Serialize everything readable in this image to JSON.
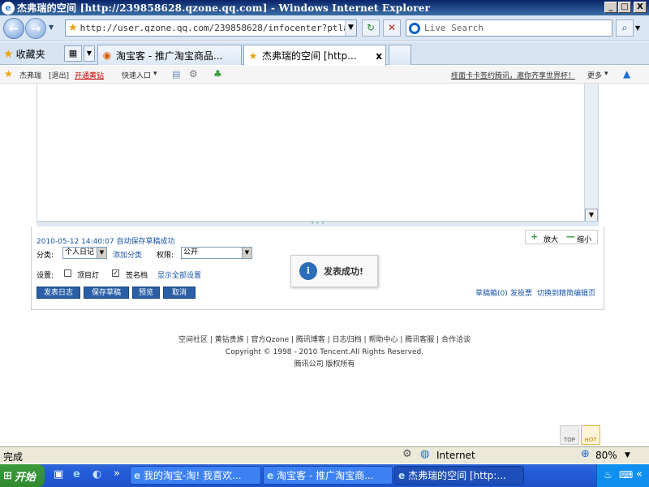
{
  "window": {
    "title": "杰弗瑞的空间 [http://239858628.qzone.qq.com] - Windows Internet Explorer",
    "min_label": "_",
    "max_label": "□",
    "close_label": "X"
  },
  "nav": {
    "back_label": "←",
    "forward_label": "→",
    "history_label": "▼",
    "address": "http://user.qzone.qq.com/239858628/infocenter?ptlang=",
    "address_dropdown": "▼",
    "refresh_label": "↻",
    "stop_label": "✕",
    "search_placeholder": "Live Search",
    "search_button_label": "⌕",
    "search_options_label": "▼"
  },
  "tabs": {
    "favorites_label": "收藏夹",
    "items": [
      {
        "label": "淘宝客 - 推广淘宝商品...",
        "active": false
      },
      {
        "label": "杰弗瑞的空间 [http...",
        "active": true
      }
    ],
    "close_label": "x"
  },
  "qzone_bar": {
    "user": "杰弗瑞",
    "logout": "[退出]",
    "open_vip": "开通黄钻",
    "quick_entry": "快速入口",
    "dropdown": "▾",
    "promo": "桂面卡卡签约腾讯，邀你齐享世界杯！",
    "more": "更多",
    "pin_label": "▲"
  },
  "editor": {
    "resize_grip": "• • •",
    "scroll_arrow": "▼",
    "autosave_status": "2010-05-12 14:40:07 自动保存草稿成功",
    "zoom_in": "放大",
    "zoom_out": "缩小",
    "category_label": "分类:",
    "category_value": "个人日记",
    "add_category": "添加分类",
    "permission_label": "权限:",
    "permission_value": "公开",
    "settings_label": "设置:",
    "option_topic": "顶目灯",
    "option_signature": "签名档",
    "option_signature_checked": "✓",
    "show_all_settings": "显示全部设置",
    "buttons": {
      "publish": "发表日志",
      "save_draft": "保存草稿",
      "preview": "预览",
      "cancel": "取消"
    },
    "drafts": "草稿箱(0)",
    "publish_link": "发投票",
    "switch_simple": "切换到精简编辑页",
    "toast_message": "发表成功!",
    "toast_icon": "i"
  },
  "footer": {
    "links": [
      "空间社区",
      "黄钻贵族",
      "官方Qzone",
      "腾讯博客",
      "日志归档",
      "帮助中心",
      "腾讯客服",
      "合作洽谈"
    ],
    "copyright": "Copyright © 1998 - 2010 Tencent.All Rights Reserved.",
    "company": "腾讯公司 版权所有",
    "top_label": "TOP",
    "hot_label": "HOT"
  },
  "status": {
    "text": "完成",
    "zone": "Internet",
    "zoom": "80%"
  },
  "taskbar": {
    "start_label": "开始",
    "more_label": "»",
    "tasks": [
      {
        "label": "我的淘宝-淘! 我喜欢...",
        "active": false
      },
      {
        "label": "淘宝客 - 推广淘宝商...",
        "active": false
      },
      {
        "label": "杰弗瑞的空间 [http:...",
        "active": true
      }
    ],
    "tray_more": "«"
  }
}
